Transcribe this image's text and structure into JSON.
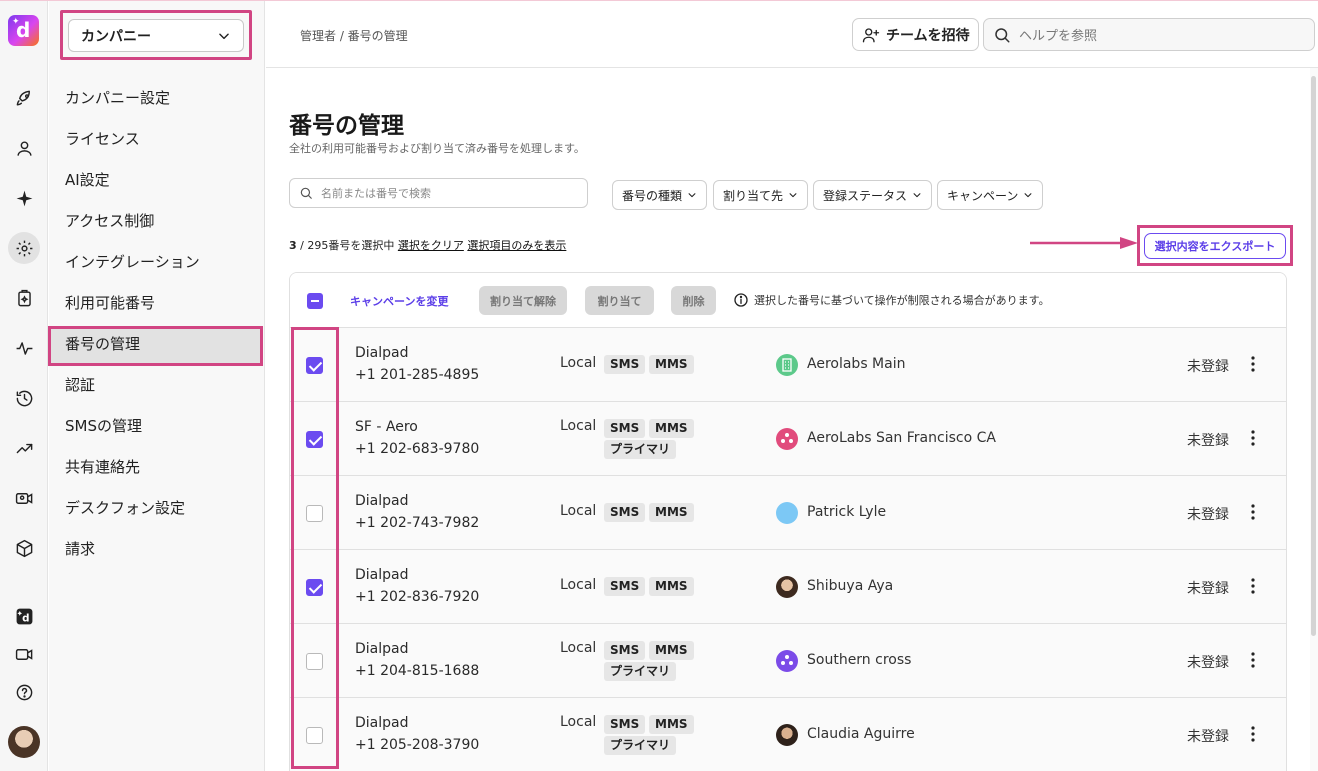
{
  "header": {
    "breadcrumb": "管理者 / 番号の管理",
    "invite_label": "チームを招待",
    "help_placeholder": "ヘルプを参照"
  },
  "sidebar": {
    "company_label": "カンパニー",
    "items": [
      {
        "label": "カンパニー設定"
      },
      {
        "label": "ライセンス"
      },
      {
        "label": "AI設定"
      },
      {
        "label": "アクセス制御"
      },
      {
        "label": "インテグレーション"
      },
      {
        "label": "利用可能番号"
      },
      {
        "label": "番号の管理"
      },
      {
        "label": "認証"
      },
      {
        "label": "SMSの管理"
      },
      {
        "label": "共有連絡先"
      },
      {
        "label": "デスクフォン設定"
      },
      {
        "label": "請求"
      }
    ]
  },
  "main": {
    "title": "番号の管理",
    "subtitle": "全社の利用可能番号および割り当て済み番号を処理します。",
    "search_placeholder": "名前または番号で検索",
    "filters": [
      "番号の種類",
      "割り当て先",
      "登録ステータス",
      "キャンペーン"
    ],
    "selection": {
      "count": "3",
      "suffix": " / 295番号を選択中",
      "clear": "選択をクリア",
      "show_selected": "選択項目のみを表示"
    },
    "export_label": "選択内容をエクスポート",
    "toolbar": {
      "change_campaign": "キャンペーンを変更",
      "unassign": "割り当て解除",
      "assign": "割り当て",
      "delete": "削除",
      "note": "選択した番号に基づいて操作が制限される場合があります。"
    },
    "rows": [
      {
        "name": "Dialpad",
        "number": "+1 201-285-4895",
        "type": "Local",
        "tags": [
          "SMS",
          "MMS"
        ],
        "primary": "",
        "assignee": "Aerolabs Main",
        "status": "未登録",
        "checked": true
      },
      {
        "name": "SF - Aero",
        "number": "+1 202-683-9780",
        "type": "Local",
        "tags": [
          "SMS",
          "MMS"
        ],
        "primary": "プライマリ",
        "assignee": "AeroLabs San Francisco CA",
        "status": "未登録",
        "checked": true
      },
      {
        "name": "Dialpad",
        "number": "+1 202-743-7982",
        "type": "Local",
        "tags": [
          "SMS",
          "MMS"
        ],
        "primary": "",
        "assignee": "Patrick Lyle",
        "status": "未登録",
        "checked": false
      },
      {
        "name": "Dialpad",
        "number": "+1 202-836-7920",
        "type": "Local",
        "tags": [
          "SMS",
          "MMS"
        ],
        "primary": "",
        "assignee": "Shibuya Aya",
        "status": "未登録",
        "checked": true
      },
      {
        "name": "Dialpad",
        "number": "+1 204-815-1688",
        "type": "Local",
        "tags": [
          "SMS",
          "MMS"
        ],
        "primary": "プライマリ",
        "assignee": "Southern cross",
        "status": "未登録",
        "checked": false
      },
      {
        "name": "Dialpad",
        "number": "+1 205-208-3790",
        "type": "Local",
        "tags": [
          "SMS",
          "MMS"
        ],
        "primary": "プライマリ",
        "assignee": "Claudia Aguirre",
        "status": "未登録",
        "checked": false
      }
    ]
  },
  "colors": {
    "accent": "#6b4bf0",
    "highlight": "#d14583"
  }
}
